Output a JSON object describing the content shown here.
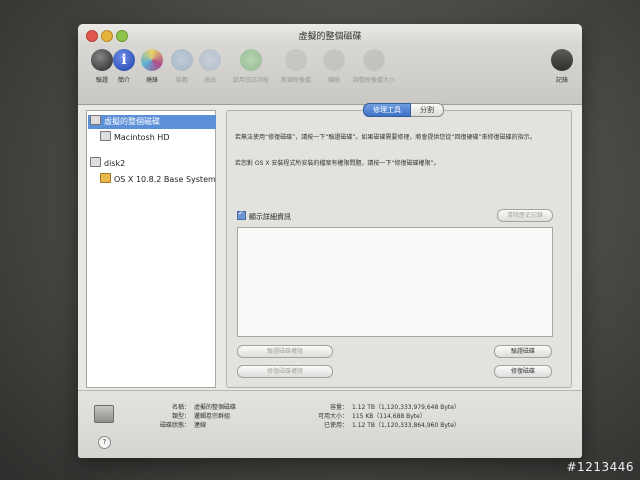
{
  "window": {
    "title": "虛擬的整個磁碟"
  },
  "toolbar": {
    "items": [
      {
        "id": "verify",
        "label": "驗證",
        "icon": "microscope-icon"
      },
      {
        "id": "info",
        "label": "簡介",
        "icon": "info-icon"
      },
      {
        "id": "burn",
        "label": "燒錄",
        "icon": "burn-disc-icon"
      },
      {
        "id": "mount",
        "label": "裝載",
        "icon": "mount-icon"
      },
      {
        "id": "eject",
        "label": "退出",
        "icon": "eject-icon"
      },
      {
        "id": "journal",
        "label": "啟用日誌功能",
        "icon": "journal-icon"
      },
      {
        "id": "newimage",
        "label": "新增映像檔",
        "icon": "new-image-icon"
      },
      {
        "id": "convert",
        "label": "轉換",
        "icon": "convert-icon"
      },
      {
        "id": "resize",
        "label": "調整映像檔大小",
        "icon": "resize-image-icon"
      },
      {
        "id": "log",
        "label": "記錄",
        "icon": "log-icon"
      }
    ]
  },
  "sidebar": {
    "items": [
      {
        "label": "虛擬的整個磁碟",
        "selected": true
      },
      {
        "label": "Macintosh HD",
        "selected": false
      },
      {
        "label": "disk2",
        "selected": false
      },
      {
        "label": "OS X 10.8.2 Base System",
        "selected": false
      }
    ]
  },
  "panel": {
    "tabs": [
      {
        "label": "修理工具",
        "active": true
      },
      {
        "label": "分割",
        "active": false
      }
    ],
    "description_1": "若無法使用“修復磁碟”，請按一下“驗證磁碟”。如果磁碟需要修理，將會提供您從“回復硬碟”來修復磁碟的指示。",
    "description_2": "若您對 OS X 安裝程式所安裝的檔案有權限問題，請按一下“修復磁碟權限”。",
    "show_details_label": "顯示詳細資訊",
    "clear_history_label": "清除歷史記錄",
    "verify_permissions_label": "驗證磁碟權限",
    "repair_permissions_label": "修復磁碟權限",
    "verify_disk_label": "驗證磁碟",
    "repair_disk_label": "修復磁碟"
  },
  "info": {
    "left": [
      {
        "key": "名稱：",
        "value": "虛擬的整個磁碟"
      },
      {
        "key": "類型：",
        "value": "邏輯卷宗群組"
      },
      {
        "key": "磁碟狀態：",
        "value": "連線"
      }
    ],
    "right": [
      {
        "key": "容量：",
        "value": "1.12 TB（1,120,333,979,648 Byte）"
      },
      {
        "key": "可用大小：",
        "value": "115 KB（114,688 Byte）"
      },
      {
        "key": "已使用：",
        "value": "1.12 TB（1,120,333,864,960 Byte）"
      }
    ]
  },
  "watermark": "#1213446"
}
